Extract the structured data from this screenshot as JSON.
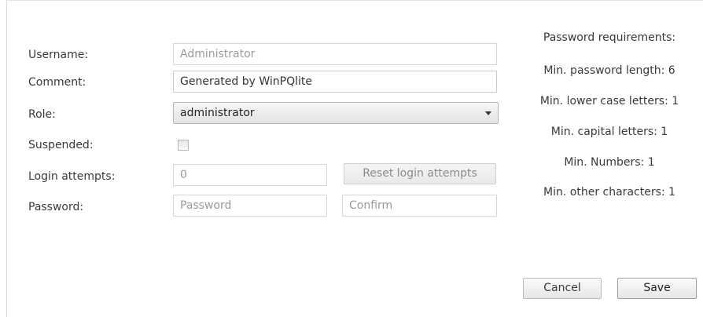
{
  "form": {
    "username": {
      "label": "Username:",
      "value": "Administrator"
    },
    "comment": {
      "label": "Comment:",
      "value": "Generated by WinPQlite"
    },
    "role": {
      "label": "Role:",
      "value": "administrator"
    },
    "suspended": {
      "label": "Suspended:",
      "checked": false
    },
    "login_attempts": {
      "label": "Login attempts:",
      "value": "0",
      "reset_label": "Reset login attempts"
    },
    "password": {
      "label": "Password:",
      "placeholder": "Password",
      "confirm_placeholder": "Confirm"
    }
  },
  "requirements": {
    "title": "Password requirements:",
    "items": [
      "Min. password length: 6",
      "Min. lower case letters: 1",
      "Min. capital letters: 1",
      "Min. Numbers: 1",
      "Min. other characters: 1"
    ]
  },
  "actions": {
    "cancel_label": "Cancel",
    "save_label": "Save"
  }
}
